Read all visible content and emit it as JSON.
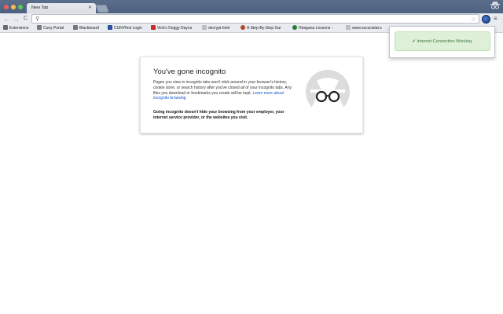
{
  "window": {
    "traffic_lights": [
      {
        "name": "close",
        "color": "#ee5f5b"
      },
      {
        "name": "minimize",
        "color": "#f6be4f"
      },
      {
        "name": "maximize",
        "color": "#62c655"
      }
    ]
  },
  "tabs": [
    {
      "label": "New Tab",
      "active": true
    }
  ],
  "toolbar": {
    "back_icon": "←",
    "forward_icon": "→",
    "reload_icon": "C",
    "search_icon": "⚲",
    "star_icon": "☆",
    "menu_icon": "≡",
    "omnibox_value": ""
  },
  "bookmarks": [
    {
      "label": "Extensions",
      "icon_color": "#6b6b6b"
    },
    {
      "label": "Cuny Portal",
      "icon_color": "#7a7a7a"
    },
    {
      "label": "Blackboard",
      "icon_color": "#777777"
    },
    {
      "label": "CUNYfirst Login",
      "icon_color": "#2b4fa0"
    },
    {
      "label": "Vick's Doggy Dayca",
      "icon_color": "#cc2a2a"
    },
    {
      "label": "decrypt.html",
      "icon_color": "#bdbdbd"
    },
    {
      "label": "A Step-By-Step Gui",
      "icon_color": "#b04a2a"
    },
    {
      "label": "Hiragana Lessons -",
      "icon_color": "#2a7a3a"
    },
    {
      "label": "www.socscistat.s",
      "icon_color": "#bdbdbd"
    }
  ],
  "card": {
    "title": "You've gone incognito",
    "body": "Pages you view in incognito tabs won't stick around in your browser's history, cookie store, or search history after you've closed all of your incognito tabs. Any files you download or bookmarks you create will be kept.",
    "link": "Learn more about incognito browsing",
    "warning": "Going incognito doesn't hide your browsing from your employer, your internet service provider, or the websites you visit."
  },
  "popup": {
    "check_icon": "✔",
    "message": "Internet Connection Working.",
    "accent": "#3c763d"
  }
}
